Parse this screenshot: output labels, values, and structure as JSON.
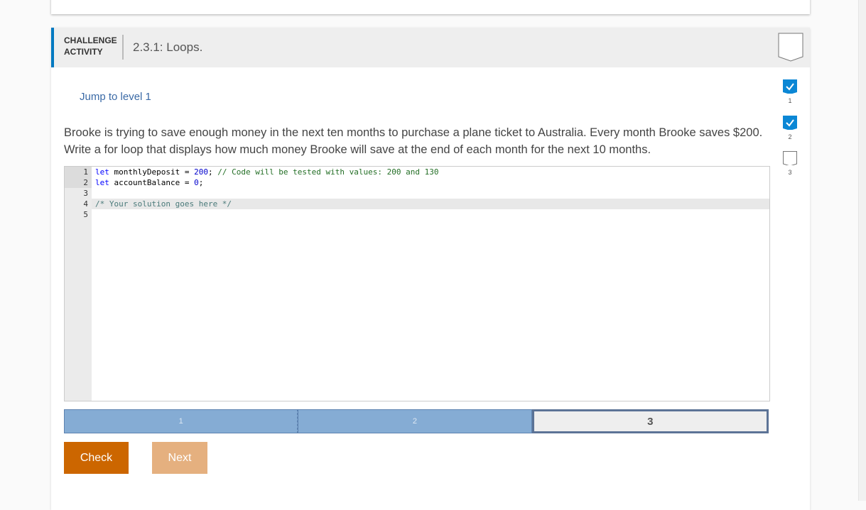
{
  "activity": {
    "label_line1": "CHALLENGE",
    "label_line2": "ACTIVITY",
    "title": "2.3.1: Loops.",
    "jump_link": "Jump to level 1",
    "prompt": "Brooke is trying to save enough money in the next ten months to purchase a plane ticket to Australia. Every month Brooke saves $200. Write a for loop that displays how much money Brooke will save at the end of each month for the next 10 months."
  },
  "editor": {
    "line_numbers": [
      "1",
      "2",
      "3",
      "4",
      "5"
    ],
    "lines": [
      {
        "kw": "let",
        "rest": " monthlyDeposit = ",
        "num": "200",
        "tail": "; ",
        "comment": "// Code will be tested with values: 200 and 130"
      },
      {
        "kw": "let",
        "rest": " accountBalance = ",
        "num": "0",
        "tail": ";",
        "comment": ""
      },
      {
        "text": ""
      },
      {
        "comment2": "/* Your solution goes here */"
      },
      {
        "text": ""
      }
    ]
  },
  "levels": [
    {
      "label": "1",
      "state": "completed"
    },
    {
      "label": "2",
      "state": "completed"
    },
    {
      "label": "3",
      "state": "current"
    }
  ],
  "buttons": {
    "check": "Check",
    "next": "Next"
  },
  "progress": {
    "items": [
      {
        "label": "1",
        "done": true
      },
      {
        "label": "2",
        "done": true
      },
      {
        "label": "3",
        "done": false
      }
    ]
  },
  "colors": {
    "accent": "#0079c1",
    "check": "#cc6600",
    "next": "#e5b07f",
    "level_done": "#85acd4"
  }
}
